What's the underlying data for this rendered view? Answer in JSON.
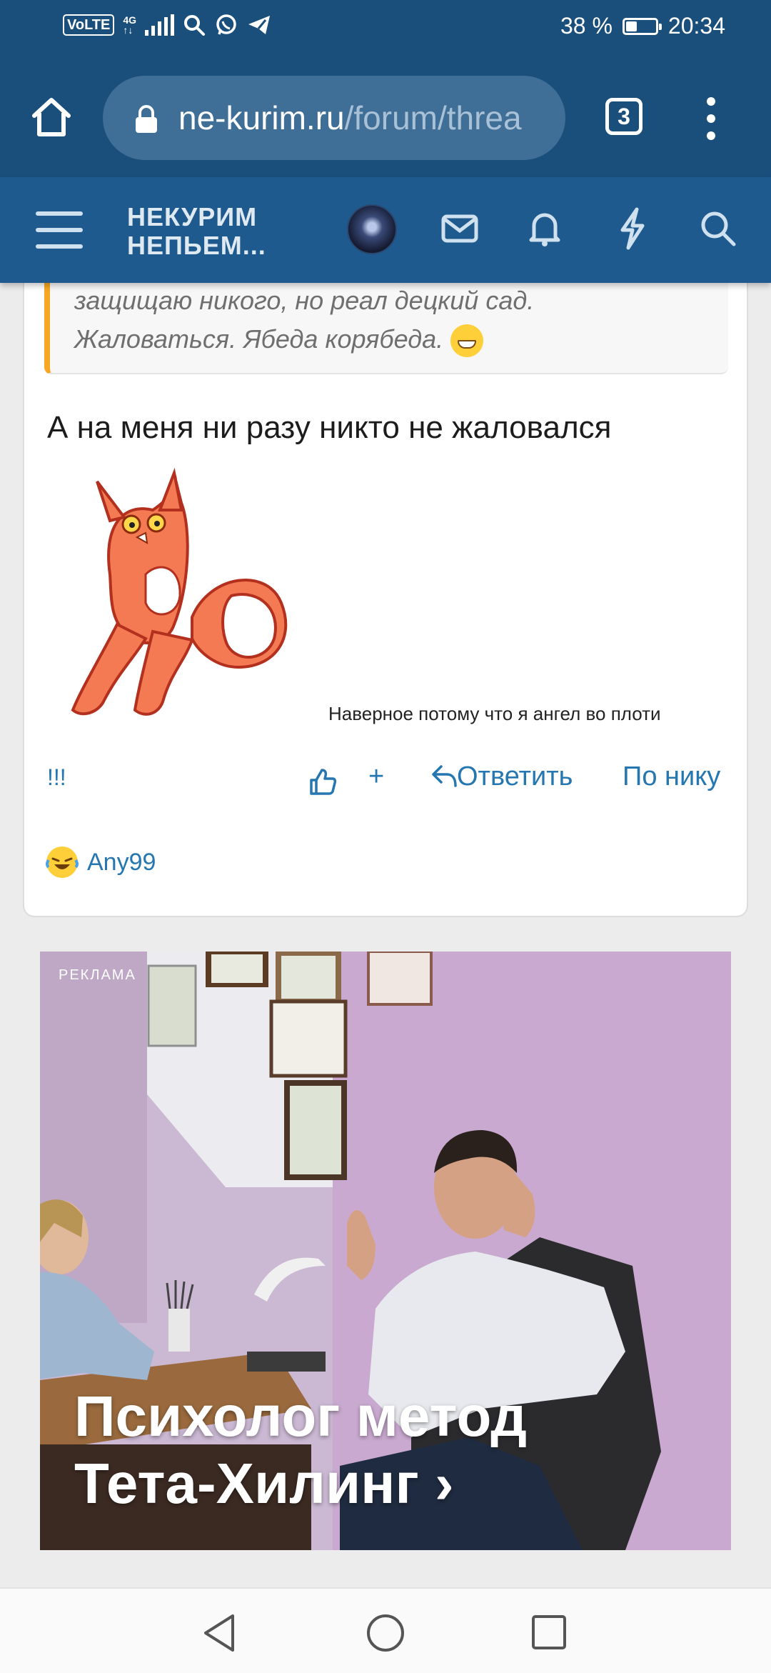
{
  "status_bar": {
    "network_type": "VoLTE",
    "signal_label": "4G",
    "battery_text": "38 %",
    "battery_level": 0.38,
    "time": "20:34",
    "notification_icons": [
      "search-icon",
      "whatsapp-icon",
      "telegram-icon"
    ]
  },
  "browser": {
    "url_host": "ne-kurim.ru",
    "url_path": "/forum/threa",
    "tab_count": "3"
  },
  "forum_header": {
    "logo_line1": "НЕКУРИМ",
    "logo_line2": "НЕПЬЕМ...",
    "icons": [
      "menu-icon",
      "mail-icon",
      "bell-icon",
      "lightning-icon",
      "search-icon"
    ]
  },
  "post": {
    "quote_line1": "защищаю никого, но реал децкий сад.",
    "quote_line2": "Жаловаться. Ябеда корябеда.",
    "message": "А на меня ни разу никто не жаловался",
    "sticker_caption": "Наверное потому что я ангел во плоти",
    "reaction_link": "!!!",
    "plus_label": "+",
    "reply_label": "Ответить",
    "by_nick_label": "По нику",
    "reaction_user": "Any99"
  },
  "ad": {
    "label": "РЕКЛАМА",
    "title_line1": "Психолог метод",
    "title_line2": "Тета-Хилинг ›"
  },
  "colors": {
    "browser_bar": "#1a4f7c",
    "forum_header": "#1e5a8d",
    "link": "#2577b1",
    "quote_accent": "#f6a623"
  }
}
